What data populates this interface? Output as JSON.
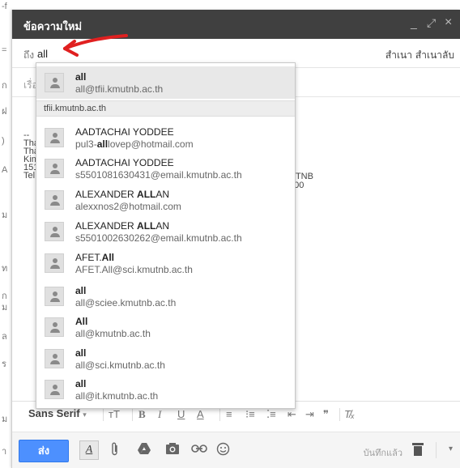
{
  "compose": {
    "title": "ข้อความใหม่",
    "window_controls": {
      "minimize": "_",
      "expand": "⤢",
      "close": "×"
    },
    "to_label": "ถึง",
    "to_value": "all",
    "cc_label": "สำเนา",
    "bcc_label": "สำเนาลับ",
    "subject_placeholder": "เรื่อง"
  },
  "body_fragments": {
    "line1": "--",
    "line2": "Tha",
    "line3": "Tha",
    "line4": "Kin",
    "line5": "151",
    "line6": "Tel.",
    "right1": "UTNB",
    "right2": "800"
  },
  "left_strip": [
    "-f",
    "=",
    "ก",
    "ฝ",
    ")",
    "A",
    "ม",
    "ท",
    "ก",
    "ม",
    "ล",
    "ร",
    "ม",
    "า"
  ],
  "autocomplete": {
    "group_label": "tfii.kmutnb.ac.th",
    "top_item": {
      "name": "all",
      "email": "all@tfii.kmutnb.ac.th"
    },
    "items": [
      {
        "name": "AADTACHAI YODDEE",
        "email_pre": "pul3-",
        "email_bold": "all",
        "email_post": "lovep@hotmail.com",
        "name_bold": "",
        "name_post": ""
      },
      {
        "name": "AADTACHAI YODDEE",
        "email_pre": "s5501081630431@email.kmutnb.ac.th",
        "email_bold": "",
        "email_post": "",
        "name_bold": "",
        "name_post": ""
      },
      {
        "name": "ALEXANDER ",
        "name_bold": "ALL",
        "name_post": "AN",
        "email_pre": "alexxnos2@hotmail.com",
        "email_bold": "",
        "email_post": ""
      },
      {
        "name": "ALEXANDER ",
        "name_bold": "ALL",
        "name_post": "AN",
        "email_pre": "s5501002630262@email.kmutnb.ac.th",
        "email_bold": "",
        "email_post": ""
      },
      {
        "name": "AFET.",
        "name_bold": "All",
        "name_post": "",
        "email_pre": "AFET.All@sci.kmutnb.ac.th",
        "email_bold": "",
        "email_post": ""
      },
      {
        "name": "",
        "name_bold": "all",
        "name_post": "",
        "email_pre": "all@sciee.kmutnb.ac.th",
        "email_bold": "",
        "email_post": ""
      },
      {
        "name": "",
        "name_bold": "All",
        "name_post": "",
        "email_pre": "all@kmutnb.ac.th",
        "email_bold": "",
        "email_post": ""
      },
      {
        "name": "",
        "name_bold": "all",
        "name_post": "",
        "email_pre": "all@sci.kmutnb.ac.th",
        "email_bold": "",
        "email_post": ""
      },
      {
        "name": "",
        "name_bold": "all",
        "name_post": "",
        "email_pre": "all@it.kmutnb.ac.th",
        "email_bold": "",
        "email_post": ""
      }
    ]
  },
  "format_toolbar": {
    "font": "Sans Serif",
    "font_caret": "▾",
    "size": "ᴛT",
    "bold": "B",
    "italic": "I",
    "underline": "U",
    "color": "A",
    "align": "≡",
    "numbered": "⁝≡",
    "bulleted": "⁚≡",
    "indent_less": "⇤",
    "indent_more": "⇥",
    "quote": "❞",
    "clear": "T̸ₓ"
  },
  "bottom_bar": {
    "send": "ส่ง",
    "format_toggle": "A",
    "saved": "บันทึกแล้ว",
    "more": "▾"
  },
  "colors": {
    "titlebar": "#404040",
    "send_button": "#4d90fe",
    "annotation_arrow": "#e02020"
  },
  "icons": {
    "attach": "paperclip-icon",
    "drive": "drive-icon",
    "photo": "camera-icon",
    "link": "link-icon",
    "emoji": "smiley-icon",
    "trash": "trash-icon"
  }
}
